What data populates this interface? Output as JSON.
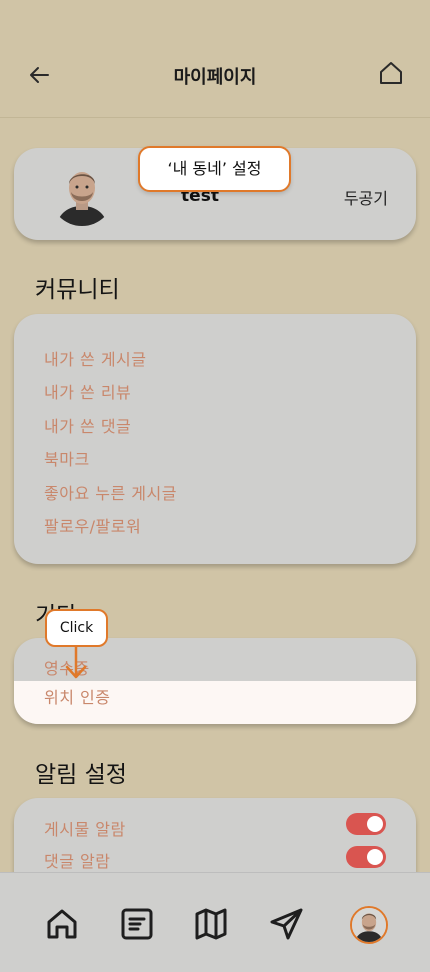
{
  "header": {
    "title": "마이페이지"
  },
  "profile": {
    "username": "test",
    "neighborhood": "두공기",
    "avatar_icon": "person-photo-icon"
  },
  "tooltips": {
    "neighborhood_setting": "‘내 동네’ 설정",
    "click": "Click"
  },
  "sections": {
    "community": {
      "title": "커뮤니티",
      "items": [
        "내가 쓴 게시글",
        "내가 쓴 리뷰",
        "내가 쓴 댓글",
        "북마크",
        "좋아요 누른 게시글",
        "팔로우/팔로워"
      ]
    },
    "etc": {
      "title": "기타",
      "items": [
        "영수증",
        "위치 인증"
      ]
    },
    "notifications": {
      "title": "알림 설정",
      "items": [
        {
          "label": "게시물 알람",
          "on": true
        },
        {
          "label": "댓글 알람",
          "on": true
        }
      ]
    }
  },
  "bottom_nav": [
    "home-icon",
    "board-icon",
    "map-icon",
    "send-icon",
    "profile-avatar"
  ],
  "colors": {
    "background": "#d0c4a6",
    "card": "#cfcfcd",
    "menu_text": "#c9876b",
    "accent": "#e0792a",
    "toggle_on": "#d95550"
  }
}
